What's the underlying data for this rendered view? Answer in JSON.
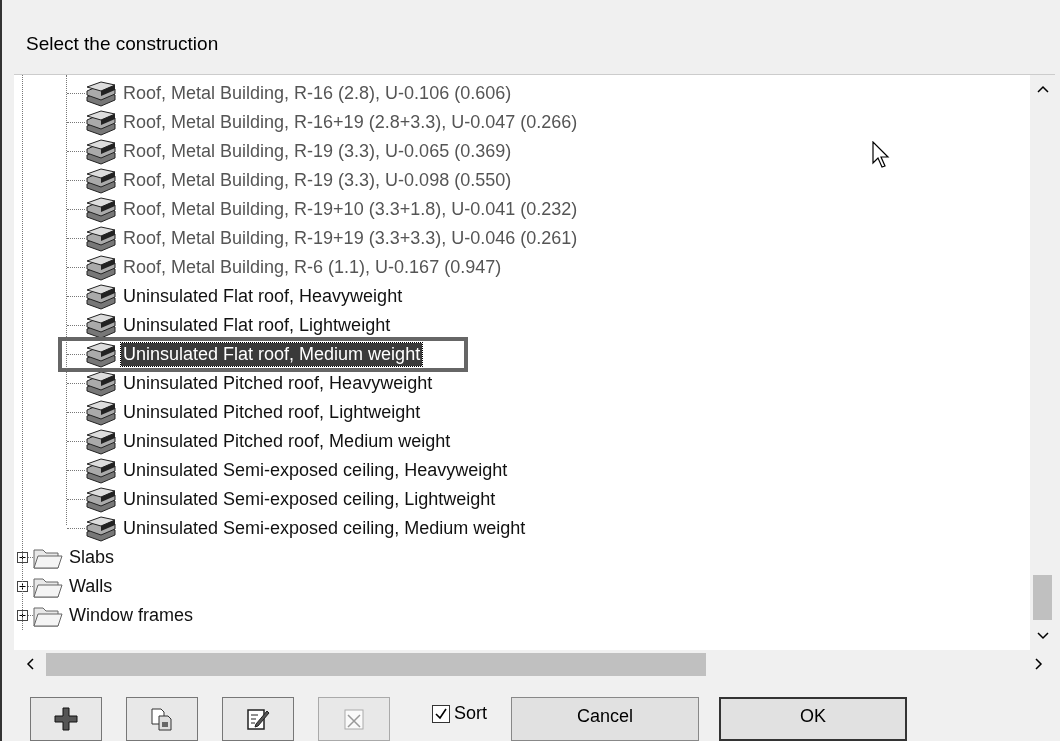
{
  "window": {
    "title": "Select the construction"
  },
  "tree": {
    "leaves": [
      {
        "label": "Roof, Metal Building, R-16 (2.8), U-0.106 (0.606)",
        "disabled": true,
        "selected": false
      },
      {
        "label": "Roof, Metal Building, R-16+19 (2.8+3.3), U-0.047 (0.266)",
        "disabled": true,
        "selected": false
      },
      {
        "label": "Roof, Metal Building, R-19 (3.3), U-0.065 (0.369)",
        "disabled": true,
        "selected": false
      },
      {
        "label": "Roof, Metal Building, R-19 (3.3), U-0.098 (0.550)",
        "disabled": true,
        "selected": false
      },
      {
        "label": "Roof, Metal Building, R-19+10 (3.3+1.8), U-0.041 (0.232)",
        "disabled": true,
        "selected": false
      },
      {
        "label": "Roof, Metal Building, R-19+19 (3.3+3.3), U-0.046 (0.261)",
        "disabled": true,
        "selected": false
      },
      {
        "label": "Roof, Metal Building, R-6 (1.1), U-0.167 (0.947)",
        "disabled": true,
        "selected": false
      },
      {
        "label": "Uninsulated Flat roof, Heavyweight",
        "disabled": false,
        "selected": false
      },
      {
        "label": "Uninsulated Flat roof, Lightweight",
        "disabled": false,
        "selected": false
      },
      {
        "label": "Uninsulated Flat roof, Medium weight",
        "disabled": false,
        "selected": true
      },
      {
        "label": "Uninsulated Pitched roof, Heavyweight",
        "disabled": false,
        "selected": false
      },
      {
        "label": "Uninsulated Pitched roof, Lightweight",
        "disabled": false,
        "selected": false
      },
      {
        "label": "Uninsulated Pitched roof, Medium weight",
        "disabled": false,
        "selected": false
      },
      {
        "label": "Uninsulated Semi-exposed ceiling, Heavyweight",
        "disabled": false,
        "selected": false
      },
      {
        "label": "Uninsulated Semi-exposed ceiling, Lightweight",
        "disabled": false,
        "selected": false
      },
      {
        "label": "Uninsulated Semi-exposed ceiling, Medium weight",
        "disabled": false,
        "selected": false
      }
    ],
    "folders": [
      {
        "label": "Slabs",
        "expanded": false
      },
      {
        "label": "Walls",
        "expanded": false
      },
      {
        "label": "Window frames",
        "expanded": false
      }
    ]
  },
  "sort": {
    "label": "Sort",
    "checked": true
  },
  "buttons": [
    {
      "label": "Cancel",
      "default": false
    },
    {
      "label": "OK",
      "default": true
    }
  ]
}
